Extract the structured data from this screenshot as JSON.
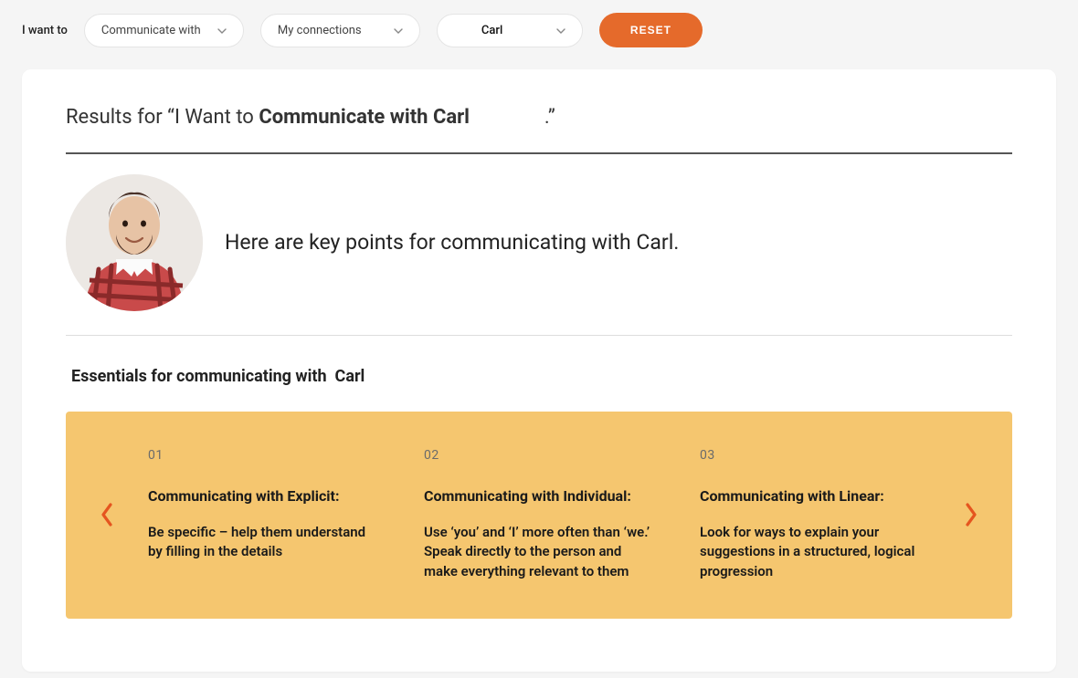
{
  "filter": {
    "label": "I want to",
    "action": "Communicate with",
    "scope": "My connections",
    "person": "Carl",
    "reset": "RESET"
  },
  "results": {
    "prefix": "Results for “I Want to ",
    "bold": "Communicate with   Carl",
    "suffix": "               .”"
  },
  "profile": {
    "intro": "Here are key points for communicating with Carl."
  },
  "essentials": {
    "title_prefix": "Essentials for communicating with  ",
    "title_name": "Carl"
  },
  "tips": [
    {
      "num": "01",
      "title": "Communicating with Explicit:",
      "body": "Be specific – help them understand by filling in the details"
    },
    {
      "num": "02",
      "title": "Communicating with Individual:",
      "body": "Use ‘you’ and ‘I’ more often than ‘we.’ Speak directly to the person and make everything relevant to them"
    },
    {
      "num": "03",
      "title": "Communicating with Linear:",
      "body": "Look for ways to explain your suggestions in a structured, logical progression"
    }
  ]
}
